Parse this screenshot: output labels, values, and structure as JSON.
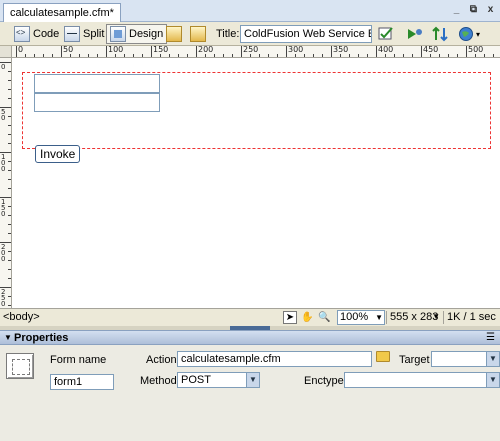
{
  "document": {
    "tab_label": "calculatesample.cfm*"
  },
  "window_controls": {
    "minimize": "_",
    "restore": "⧉",
    "close": "x"
  },
  "toolbar": {
    "code_label": "Code",
    "split_label": "Split",
    "design_label": "Design",
    "title_label": "Title:",
    "title_value": "ColdFusion Web Service Exam"
  },
  "ruler": {
    "h_labels": [
      "0",
      "50",
      "100",
      "150",
      "200",
      "250",
      "300",
      "350",
      "400",
      "450",
      "500"
    ],
    "v_labels": [
      "0",
      "50",
      "100",
      "150",
      "200",
      "250"
    ]
  },
  "canvas": {
    "invoke_button": "Invoke"
  },
  "statusbar": {
    "tag_selector": "<body>",
    "zoom": "100%",
    "window_size": "555 x 283",
    "download_stat": "1K / 1 sec"
  },
  "properties": {
    "panel_title": "Properties",
    "form_name_label": "Form name",
    "form_name_value": "form1",
    "action_label": "Action",
    "action_value": "calculatesample.cfm",
    "target_label": "Target",
    "target_value": "",
    "method_label": "Method",
    "method_value": "POST",
    "enctype_label": "Enctype",
    "enctype_value": ""
  },
  "colors": {
    "form_outline": "#e33333",
    "panel_header": "#aebfd9"
  }
}
